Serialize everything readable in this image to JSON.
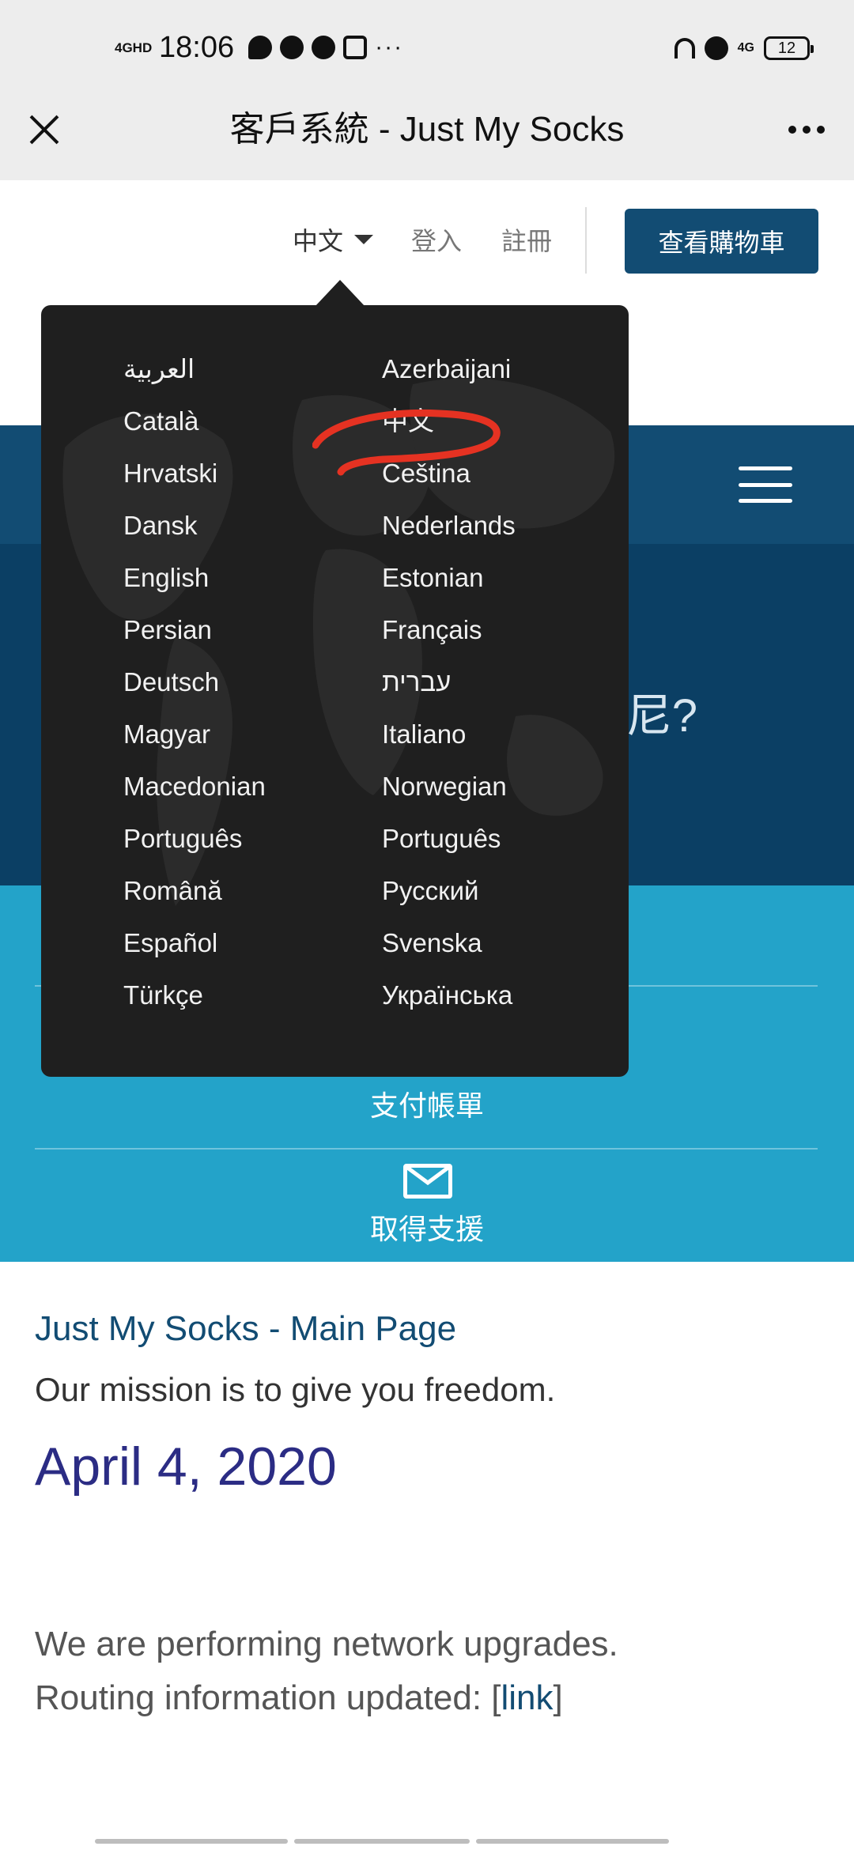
{
  "status_bar": {
    "network": "4GHD",
    "time": "18:06",
    "right_network": "4G",
    "battery": "12",
    "more": "···"
  },
  "title_bar": {
    "title": "客戶系統 - Just My Socks"
  },
  "nav": {
    "language": "中文",
    "login": "登入",
    "register": "註冊",
    "cart": "查看購物車"
  },
  "hero": {
    "text_visible": "尼?"
  },
  "actions": {
    "pay_bill": "支付帳單",
    "get_support": "取得支援"
  },
  "content": {
    "main_page_link": "Just My Socks - Main Page",
    "mission": "Our mission is to give you freedom.",
    "date": "April 4, 2020",
    "notice_line1": "We are performing network upgrades.",
    "notice_line2_prefix": "Routing information updated: [",
    "notice_link": "link",
    "notice_line2_suffix": "]"
  },
  "language_menu": {
    "column1": [
      "العربية",
      "Català",
      "Hrvatski",
      "Dansk",
      "English",
      "Persian",
      "Deutsch",
      "Magyar",
      "Macedonian",
      "Português",
      "Română",
      "Español",
      "Türkçe"
    ],
    "column2": [
      "Azerbaijani",
      "中文",
      "Čeština",
      "Nederlands",
      "Estonian",
      "Français",
      "עברית",
      "Italiano",
      "Norwegian",
      "Português",
      "Русский",
      "Svenska",
      "Українська"
    ]
  },
  "colors": {
    "brand_dark": "#124c73",
    "hero": "#0b3f64",
    "panel": "#23a3c9",
    "menu_bg": "#1f1f1f",
    "date": "#2b2c84",
    "annotation": "#e53222"
  }
}
